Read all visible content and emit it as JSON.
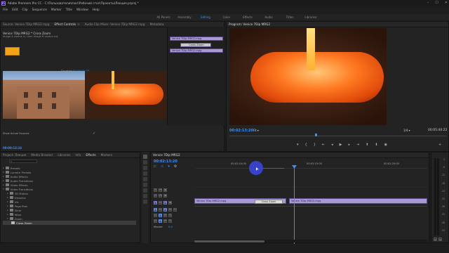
{
  "app": {
    "icon_text": "Pr",
    "title": "Adobe Premiere Pro CC - C:\\Пользователи\\mari\\Рабочий стол\\Проекты\\Лекция.prproj *"
  },
  "menu": [
    "File",
    "Edit",
    "Clip",
    "Sequence",
    "Marker",
    "Title",
    "Window",
    "Help"
  ],
  "workspaces": {
    "tabs": [
      "All Panels",
      "Assembly",
      "Editing",
      "Color",
      "Effects",
      "Audio",
      "Titles",
      "Libraries"
    ],
    "active": "Editing"
  },
  "effect_controls": {
    "tabs": [
      "Source: Venice 7Dip MRG2.mpg",
      "Effect Controls",
      "Audio Clip Mixer: Venice 7Dip MRG2.mpg",
      "Metadata"
    ],
    "active_tab": "Effect Controls",
    "clip_name": "Venice 7Dip MRG2 * Cross Zoom",
    "description": "Image A zooms in, then image B zooms out.",
    "duration_label": "Duration",
    "duration_value": "00:00:01:00",
    "alignment_label": "Alignment:",
    "alignment_value": "Center at Cut",
    "start_label": "Start:",
    "start_value": "0.0",
    "end_label": "End:",
    "end_value": "100.0",
    "show_actual_sources": "Show Actual Sources",
    "timecode": "00:00:12:24"
  },
  "mini_timeline": {
    "clip_a": "Venice 7Dip MRG2.mpg",
    "transition": "Cross Zoom",
    "clip_b": "Venice 7Dip MRG2.mpg"
  },
  "program": {
    "title": "Program: Venice 7Dip MRG2",
    "timecode": "00:02:13:20",
    "fit": "Fit",
    "quality": "1/4",
    "duration": "00:05:40:22"
  },
  "project": {
    "tabs": [
      "Project: Лекция",
      "Media Browser",
      "Libraries",
      "Info",
      "Effects",
      "Markers"
    ],
    "active_tab": "Effects",
    "tree": [
      {
        "label": "Presets",
        "level": 0,
        "expanded": false
      },
      {
        "label": "Lumetri Presets",
        "level": 0,
        "expanded": false
      },
      {
        "label": "Audio Effects",
        "level": 0,
        "expanded": false
      },
      {
        "label": "Audio Transitions",
        "level": 0,
        "expanded": false
      },
      {
        "label": "Video Effects",
        "level": 0,
        "expanded": false
      },
      {
        "label": "Video Transitions",
        "level": 0,
        "expanded": true
      },
      {
        "label": "3D Motion",
        "level": 1,
        "expanded": false
      },
      {
        "label": "Dissolve",
        "level": 1,
        "expanded": false
      },
      {
        "label": "Iris",
        "level": 1,
        "expanded": false
      },
      {
        "label": "Page Peel",
        "level": 1,
        "expanded": false
      },
      {
        "label": "Slide",
        "level": 1,
        "expanded": false
      },
      {
        "label": "Wipe",
        "level": 1,
        "expanded": false
      },
      {
        "label": "Zoom",
        "level": 1,
        "expanded": true
      },
      {
        "label": "Cross Zoom",
        "level": 2,
        "expanded": false,
        "selected": true
      }
    ]
  },
  "timeline": {
    "sequence_tab": "Venice 7Dip MRG2",
    "timecode": "00:02:13:20",
    "ruler": [
      "00:02:10:00",
      "00:02:15:00",
      "00:02:20:00"
    ],
    "tracks_video": [
      "V3",
      "V2",
      "V1"
    ],
    "tracks_audio": [
      "A1",
      "A2",
      "A3"
    ],
    "master_label": "Master",
    "master_value": "0.0",
    "clip_left": "Venice 7Dip MRG2.mpg",
    "clip_right": "Venice 7Dip MRG2.mpg",
    "transition": "Cross Zoom"
  },
  "meters": {
    "labels": [
      "0",
      "-6",
      "-12",
      "-18",
      "-24",
      "-30",
      "-36",
      "-42",
      "-48",
      "-54"
    ],
    "bottom": [
      "S",
      "S"
    ]
  },
  "colors": {
    "accent": "#3c8eff",
    "clip": "#a99ad6",
    "glass": "#ff6a1a"
  }
}
